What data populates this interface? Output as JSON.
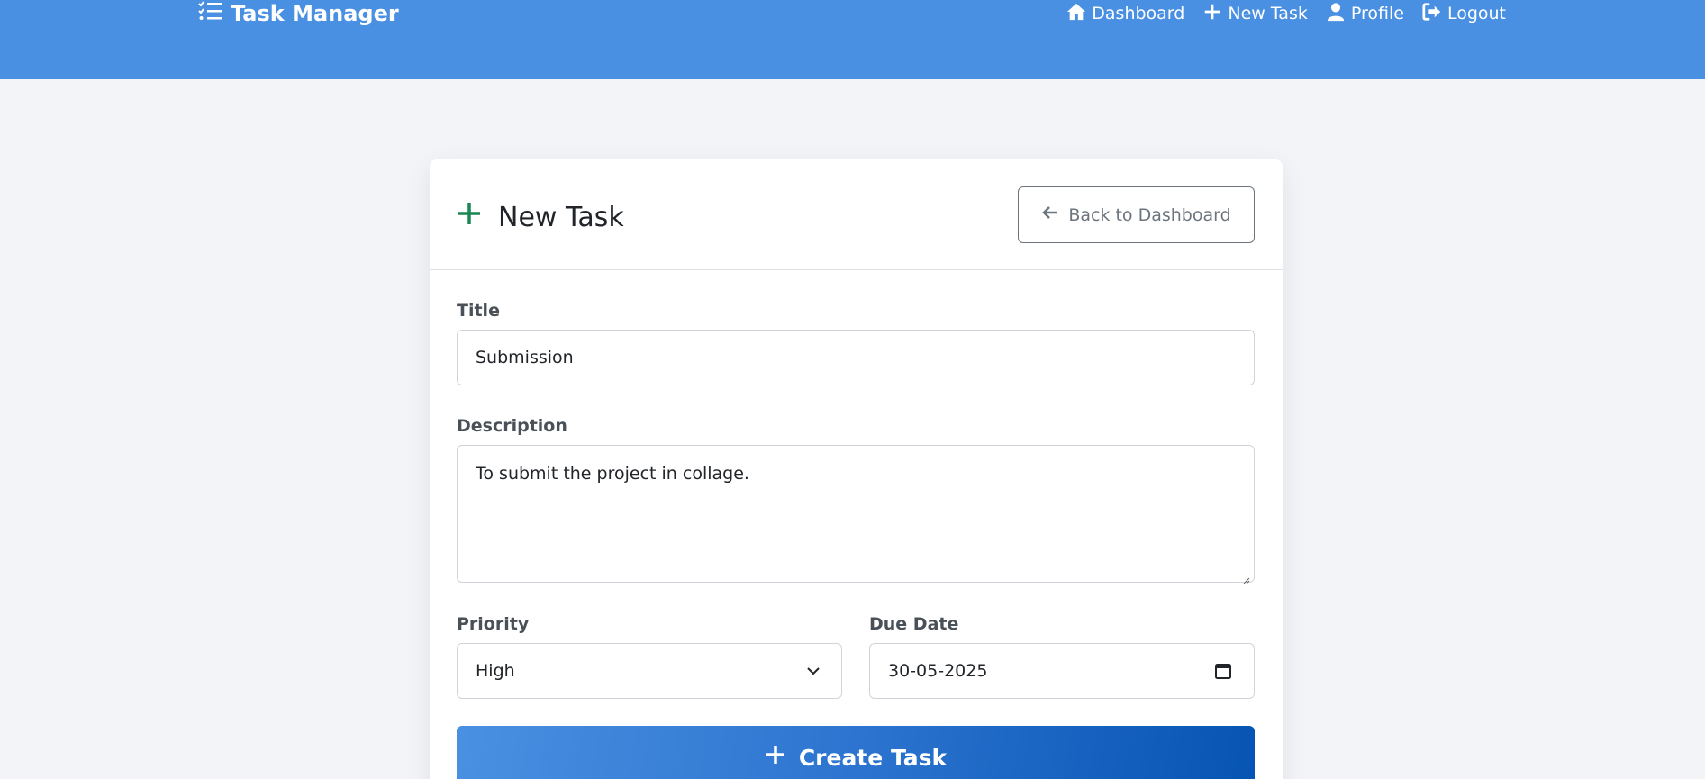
{
  "navbar": {
    "brand": "Task Manager",
    "brand_icon": "tasks-list-icon",
    "links": [
      {
        "label": "Dashboard",
        "icon": "home-icon"
      },
      {
        "label": "New Task",
        "icon": "plus-icon"
      },
      {
        "label": "Profile",
        "icon": "user-icon"
      },
      {
        "label": "Logout",
        "icon": "logout-icon"
      }
    ],
    "color": "#4a90e2"
  },
  "card": {
    "title": "New Task",
    "title_icon": "plus-icon",
    "title_icon_color": "#198754",
    "back_button": "Back to Dashboard"
  },
  "form": {
    "title_label": "Title",
    "title_value": "Submission",
    "description_label": "Description",
    "description_value": "To submit the project in collage.",
    "priority_label": "Priority",
    "priority_value": "High",
    "due_date_label": "Due Date",
    "due_date_value": "30-05-2025",
    "submit_label": "Create Task"
  }
}
